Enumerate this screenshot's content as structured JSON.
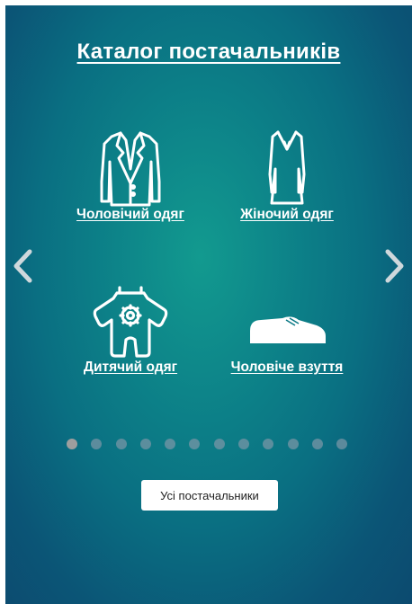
{
  "title": "Каталог постачальників",
  "categories": [
    {
      "label": "Чоловічий одяг",
      "icon": "jacket-icon"
    },
    {
      "label": "Жіночий одяг",
      "icon": "dress-icon"
    },
    {
      "label": "Дитячий одяг",
      "icon": "baby-onesie-icon"
    },
    {
      "label": "Чоловіче взуття",
      "icon": "shoe-icon"
    }
  ],
  "carousel": {
    "prev_icon": "chevron-left-icon",
    "next_icon": "chevron-right-icon",
    "dot_count": 12,
    "active_dot": 1
  },
  "all_suppliers_label": "Усі постачальники",
  "colors": {
    "background_center": "#129a8f",
    "background_edge": "#0c4a6f",
    "text": "#ffffff",
    "dot_active": "#9e9e9e"
  }
}
